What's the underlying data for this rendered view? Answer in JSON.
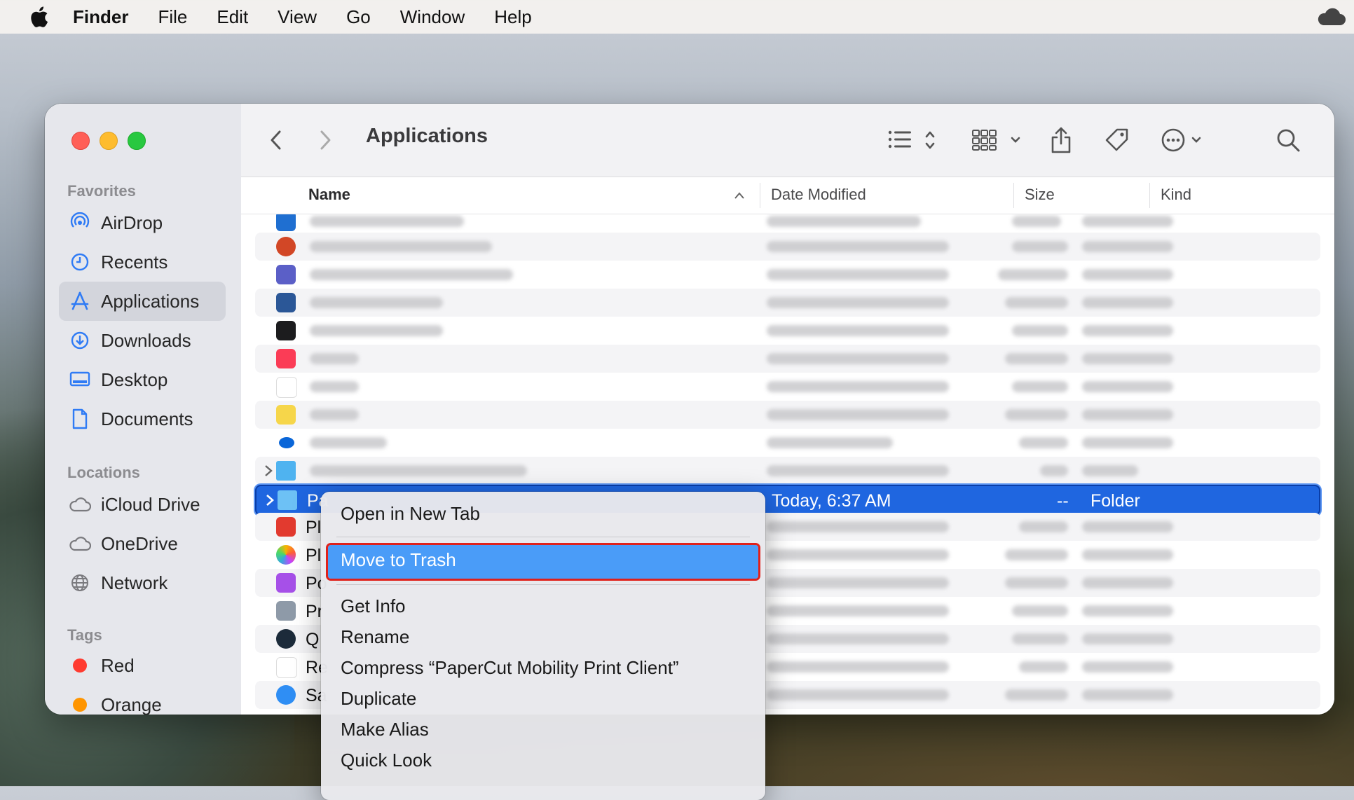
{
  "menubar": {
    "items": [
      "Finder",
      "File",
      "Edit",
      "View",
      "Go",
      "Window",
      "Help"
    ]
  },
  "window": {
    "title": "Applications",
    "sidebar": {
      "favorites_label": "Favorites",
      "favorites": [
        {
          "label": "AirDrop",
          "icon": "airdrop-icon"
        },
        {
          "label": "Recents",
          "icon": "clock-icon"
        },
        {
          "label": "Applications",
          "icon": "applications-icon",
          "active": true
        },
        {
          "label": "Downloads",
          "icon": "download-icon"
        },
        {
          "label": "Desktop",
          "icon": "desktop-icon"
        },
        {
          "label": "Documents",
          "icon": "document-icon"
        }
      ],
      "locations_label": "Locations",
      "locations": [
        {
          "label": "iCloud Drive",
          "icon": "cloud-icon"
        },
        {
          "label": "OneDrive",
          "icon": "cloud-icon"
        },
        {
          "label": "Network",
          "icon": "globe-icon"
        }
      ],
      "tags_label": "Tags",
      "tags": [
        {
          "label": "Red",
          "color": "#ff3b30"
        },
        {
          "label": "Orange",
          "color": "#ff9500"
        }
      ]
    },
    "columns": {
      "name": "Name",
      "date": "Date Modified",
      "size": "Size",
      "kind": "Kind"
    },
    "selected_row": {
      "name_prefix": "Pa",
      "date": "Today, 6:37 AM",
      "size": "--",
      "kind": "Folder"
    },
    "partial_names": [
      "Pl",
      "Pl",
      "Po",
      "Pr",
      "Q",
      "Re",
      "Sa"
    ]
  },
  "context_menu": {
    "items": [
      "Open in New Tab",
      "Move to Trash",
      "Get Info",
      "Rename",
      "Compress “PaperCut Mobility Print Client”",
      "Duplicate",
      "Make Alias",
      "Quick Look"
    ],
    "highlighted": "Move to Trash"
  },
  "colors": {
    "selection": "#1f66e0",
    "highlight": "#4a9cf8",
    "annotation_box": "#e0211b"
  }
}
